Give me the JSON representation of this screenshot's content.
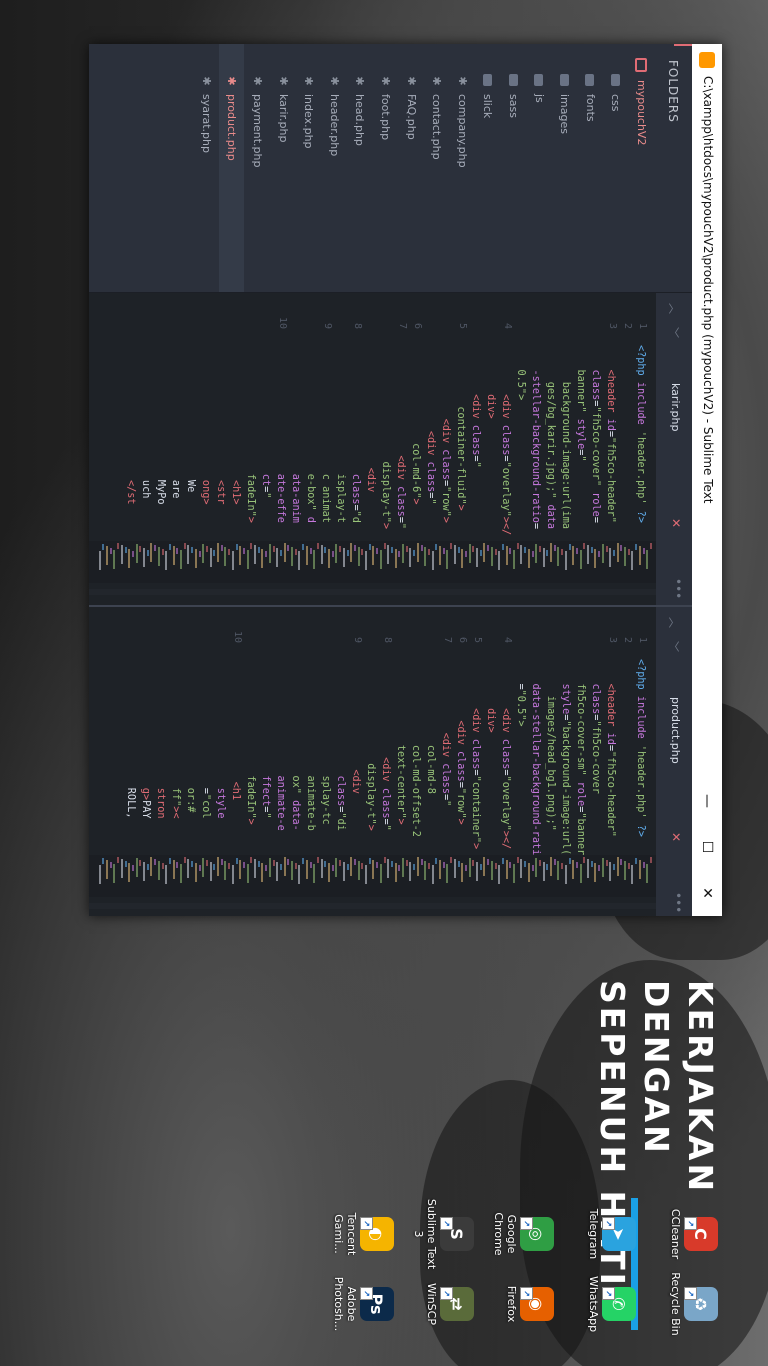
{
  "window": {
    "title": "C:\\xampp\\htdocs\\mypouchV2\\product.php (mypouchV2) - Sublime Text",
    "minimize": "—",
    "maximize": "☐",
    "close": "✕"
  },
  "sidebar": {
    "header": "FOLDERS",
    "root": "mypouchV2",
    "folders": [
      "css",
      "fonts",
      "images",
      "js",
      "sass",
      "slick"
    ],
    "files": [
      "company.php",
      "contact.php",
      "FAQ.php",
      "foot.php",
      "head.php",
      "header.php",
      "index.php",
      "karir.php",
      "payment.php",
      "product.php",
      "syarat.php"
    ],
    "active_file": "product.php"
  },
  "panes": [
    {
      "tab": "karir.php",
      "close": "✕",
      "more": "•••",
      "line_numbers": [
        "1",
        "2",
        "3",
        "",
        "4",
        "5",
        "",
        "6",
        "7",
        "8",
        "9",
        "10"
      ],
      "code": [
        [
          [
            "t-php",
            "<?php "
          ],
          [
            "t-att",
            "include "
          ],
          [
            "t-str",
            "'header.php'"
          ],
          [
            "t-php",
            " ?>"
          ]
        ],
        [
          [
            "t-txt",
            ""
          ]
        ],
        [
          [
            "t-txt",
            "    "
          ],
          [
            "t-tag",
            "<header "
          ],
          [
            "t-att",
            "id"
          ],
          [
            "t-txt",
            "="
          ],
          [
            "t-str",
            "\"fh5co-header\""
          ]
        ],
        [
          [
            "t-att",
            "    class"
          ],
          [
            "t-txt",
            "="
          ],
          [
            "t-str",
            "\"fh5co-cover\" "
          ],
          [
            "t-att",
            "role"
          ],
          [
            "t-txt",
            "="
          ]
        ],
        [
          [
            "t-str",
            "    banner\" "
          ],
          [
            "t-att",
            "style"
          ],
          [
            "t-txt",
            "="
          ],
          [
            "t-str",
            "\""
          ]
        ],
        [
          [
            "t-str",
            "      background-image:url(ima"
          ]
        ],
        [
          [
            "t-str",
            "      ges/bg_karir.jpg);\" "
          ],
          [
            "t-att",
            "data"
          ]
        ],
        [
          [
            "t-att",
            "    -stellar-background-ratio"
          ],
          [
            "t-txt",
            "="
          ]
        ],
        [
          [
            "t-str",
            "    0.5\">"
          ]
        ],
        [
          [
            "t-txt",
            "        "
          ],
          [
            "t-tag",
            "<div "
          ],
          [
            "t-att",
            "class"
          ],
          [
            "t-txt",
            "="
          ],
          [
            "t-str",
            "\"overlay\""
          ],
          [
            "t-tag",
            "></"
          ]
        ],
        [
          [
            "t-tag",
            "        div>"
          ]
        ],
        [
          [
            "t-txt",
            "        "
          ],
          [
            "t-tag",
            "<div "
          ],
          [
            "t-att",
            "class"
          ],
          [
            "t-txt",
            "="
          ],
          [
            "t-str",
            "\""
          ]
        ],
        [
          [
            "t-str",
            "          container-fluid\""
          ],
          [
            "t-tag",
            ">"
          ]
        ],
        [
          [
            "t-txt",
            "            "
          ],
          [
            "t-tag",
            "<div "
          ],
          [
            "t-att",
            "class"
          ],
          [
            "t-txt",
            "="
          ],
          [
            "t-str",
            "\"row\""
          ],
          [
            "t-tag",
            ">"
          ]
        ],
        [
          [
            "t-txt",
            "              "
          ],
          [
            "t-tag",
            "<div "
          ],
          [
            "t-att",
            "class"
          ],
          [
            "t-txt",
            "="
          ],
          [
            "t-str",
            "\""
          ]
        ],
        [
          [
            "t-str",
            "                col-md-6\""
          ],
          [
            "t-tag",
            ">"
          ]
        ],
        [
          [
            "t-txt",
            "                  "
          ],
          [
            "t-tag",
            "<div "
          ],
          [
            "t-att",
            "class"
          ],
          [
            "t-txt",
            "="
          ],
          [
            "t-str",
            "\""
          ]
        ],
        [
          [
            "t-str",
            "                   display-t\""
          ],
          [
            "t-tag",
            ">"
          ]
        ],
        [
          [
            "t-txt",
            "                    "
          ],
          [
            "t-tag",
            "<div"
          ]
        ],
        [
          [
            "t-att",
            "                     class"
          ],
          [
            "t-txt",
            "="
          ],
          [
            "t-str",
            "\"d"
          ]
        ],
        [
          [
            "t-str",
            "                     isplay-t"
          ]
        ],
        [
          [
            "t-str",
            "                     c animat"
          ]
        ],
        [
          [
            "t-str",
            "                     e-box\" "
          ],
          [
            "t-att",
            "d"
          ]
        ],
        [
          [
            "t-att",
            "                     ata-anim"
          ]
        ],
        [
          [
            "t-att",
            "                     ate-effe"
          ]
        ],
        [
          [
            "t-att",
            "                     ct"
          ],
          [
            "t-txt",
            "="
          ],
          [
            "t-str",
            "\""
          ]
        ],
        [
          [
            "t-str",
            "                     fadeIn\""
          ],
          [
            "t-tag",
            ">"
          ]
        ],
        [
          [
            "t-txt",
            "                      "
          ],
          [
            "t-tag",
            "<h1>"
          ]
        ],
        [
          [
            "t-txt",
            "                      "
          ],
          [
            "t-tag",
            "<str"
          ]
        ],
        [
          [
            "t-tag",
            "                      ong>"
          ]
        ],
        [
          [
            "t-txt",
            "                      We"
          ]
        ],
        [
          [
            "t-txt",
            "                      are"
          ]
        ],
        [
          [
            "t-txt",
            "                      MyPo"
          ]
        ],
        [
          [
            "t-txt",
            "                      uch"
          ]
        ],
        [
          [
            "t-txt",
            "                      "
          ],
          [
            "t-tag",
            "</st"
          ]
        ]
      ]
    },
    {
      "tab": "product.php",
      "close": "✕",
      "more": "•••",
      "line_numbers": [
        "1",
        "2",
        "3",
        "",
        "",
        "",
        "",
        "4",
        "5",
        "6",
        "7",
        "8",
        "9",
        "10"
      ],
      "code": [
        [
          [
            "t-php",
            "<?php "
          ],
          [
            "t-att",
            "include "
          ],
          [
            "t-str",
            "'header.php'"
          ],
          [
            "t-php",
            " ?>"
          ]
        ],
        [
          [
            "t-txt",
            ""
          ]
        ],
        [
          [
            "t-txt",
            "    "
          ],
          [
            "t-tag",
            "<header "
          ],
          [
            "t-att",
            "id"
          ],
          [
            "t-txt",
            "="
          ],
          [
            "t-str",
            "\"fh5co-header\""
          ]
        ],
        [
          [
            "t-att",
            "    class"
          ],
          [
            "t-txt",
            "="
          ],
          [
            "t-str",
            "\"fh5co-cover"
          ]
        ],
        [
          [
            "t-str",
            "    fh5co-cover-sm\" "
          ],
          [
            "t-att",
            "role"
          ],
          [
            "t-txt",
            "="
          ],
          [
            "t-str",
            "\"banner\""
          ]
        ],
        [
          [
            "t-att",
            "    style"
          ],
          [
            "t-txt",
            "="
          ],
          [
            "t-str",
            "\"background-image:url("
          ]
        ],
        [
          [
            "t-str",
            "      images/head_bg1.png);\""
          ]
        ],
        [
          [
            "t-att",
            "    data-stellar-background-ratio"
          ]
        ],
        [
          [
            "t-txt",
            "    ="
          ],
          [
            "t-str",
            "\"0.5\">"
          ]
        ],
        [
          [
            "t-txt",
            "        "
          ],
          [
            "t-tag",
            "<div "
          ],
          [
            "t-att",
            "class"
          ],
          [
            "t-txt",
            "="
          ],
          [
            "t-str",
            "\"overlay\""
          ],
          [
            "t-tag",
            "></"
          ]
        ],
        [
          [
            "t-tag",
            "        div>"
          ]
        ],
        [
          [
            "t-txt",
            "        "
          ],
          [
            "t-tag",
            "<div "
          ],
          [
            "t-att",
            "class"
          ],
          [
            "t-txt",
            "="
          ],
          [
            "t-str",
            "\"container\""
          ],
          [
            "t-tag",
            ">"
          ]
        ],
        [
          [
            "t-txt",
            "          "
          ],
          [
            "t-tag",
            "<div "
          ],
          [
            "t-att",
            "class"
          ],
          [
            "t-txt",
            "="
          ],
          [
            "t-str",
            "\"row\""
          ],
          [
            "t-tag",
            ">"
          ]
        ],
        [
          [
            "t-txt",
            "            "
          ],
          [
            "t-tag",
            "<div "
          ],
          [
            "t-att",
            "class"
          ],
          [
            "t-txt",
            "="
          ],
          [
            "t-str",
            "\""
          ]
        ],
        [
          [
            "t-str",
            "              col-md-8"
          ]
        ],
        [
          [
            "t-str",
            "              col-md-offset-2"
          ]
        ],
        [
          [
            "t-str",
            "              text-center\""
          ],
          [
            "t-tag",
            ">"
          ]
        ],
        [
          [
            "t-txt",
            "                "
          ],
          [
            "t-tag",
            "<div "
          ],
          [
            "t-att",
            "class"
          ],
          [
            "t-txt",
            "="
          ],
          [
            "t-str",
            "\""
          ]
        ],
        [
          [
            "t-str",
            "                 display-t\""
          ],
          [
            "t-tag",
            ">"
          ]
        ],
        [
          [
            "t-txt",
            "                  "
          ],
          [
            "t-tag",
            "<div"
          ]
        ],
        [
          [
            "t-att",
            "                   class"
          ],
          [
            "t-txt",
            "="
          ],
          [
            "t-str",
            "\"di"
          ]
        ],
        [
          [
            "t-str",
            "                   splay-tc"
          ]
        ],
        [
          [
            "t-str",
            "                   animate-b"
          ]
        ],
        [
          [
            "t-str",
            "                   ox\" "
          ],
          [
            "t-att",
            "data-"
          ]
        ],
        [
          [
            "t-att",
            "                   animate-e"
          ]
        ],
        [
          [
            "t-att",
            "                   ffect"
          ],
          [
            "t-txt",
            "="
          ],
          [
            "t-str",
            "\""
          ]
        ],
        [
          [
            "t-str",
            "                   fadeIn\""
          ],
          [
            "t-tag",
            ">"
          ]
        ],
        [
          [
            "t-txt",
            "                    "
          ],
          [
            "t-tag",
            "<h1"
          ]
        ],
        [
          [
            "t-att",
            "                     style"
          ]
        ],
        [
          [
            "t-txt",
            "                     ="
          ],
          [
            "t-str",
            "\"col"
          ]
        ],
        [
          [
            "t-str",
            "                     or:#"
          ]
        ],
        [
          [
            "t-str",
            "                     ff\""
          ],
          [
            "t-tag",
            ">"
          ],
          [
            "t-tag",
            "<"
          ]
        ],
        [
          [
            "t-tag",
            "                     stron"
          ]
        ],
        [
          [
            "t-tag",
            "                     g>"
          ],
          [
            "t-txt",
            "PAY"
          ]
        ],
        [
          [
            "t-txt",
            "                     ROLL,"
          ]
        ]
      ]
    }
  ],
  "wallpaper": {
    "line1": "KERJAKAN DENGAN",
    "line2": "SEPENUH HATI",
    "accent": "#1aa0e6"
  },
  "desktop_icons": [
    {
      "name": "recycle-bin",
      "label": "Recycle Bin",
      "color": "#7aa6c8",
      "glyph": "♻"
    },
    {
      "name": "ccleaner",
      "label": "CCleaner",
      "color": "#d83a2a",
      "glyph": "C"
    },
    {
      "name": "whatsapp",
      "label": "WhatsApp",
      "color": "#25d366",
      "glyph": "✆"
    },
    {
      "name": "telegram",
      "label": "Telegram",
      "color": "#2aa3df",
      "glyph": "➤"
    },
    {
      "name": "firefox",
      "label": "Firefox",
      "color": "#e66000",
      "glyph": "◉"
    },
    {
      "name": "google-chrome",
      "label": "Google Chrome",
      "color": "#2f9e44",
      "glyph": "◎"
    },
    {
      "name": "winscp",
      "label": "WinSCP",
      "color": "#5a6b3a",
      "glyph": "⇄"
    },
    {
      "name": "sublime-text",
      "label": "Sublime Text 3",
      "color": "#3b3b3b",
      "glyph": "S"
    },
    {
      "name": "photoshop",
      "label": "Adobe Photosh...",
      "color": "#0c2a4a",
      "glyph": "Ps"
    },
    {
      "name": "tencent-gaming",
      "label": "Tencent Gami...",
      "color": "#f5b400",
      "glyph": "◐"
    }
  ]
}
